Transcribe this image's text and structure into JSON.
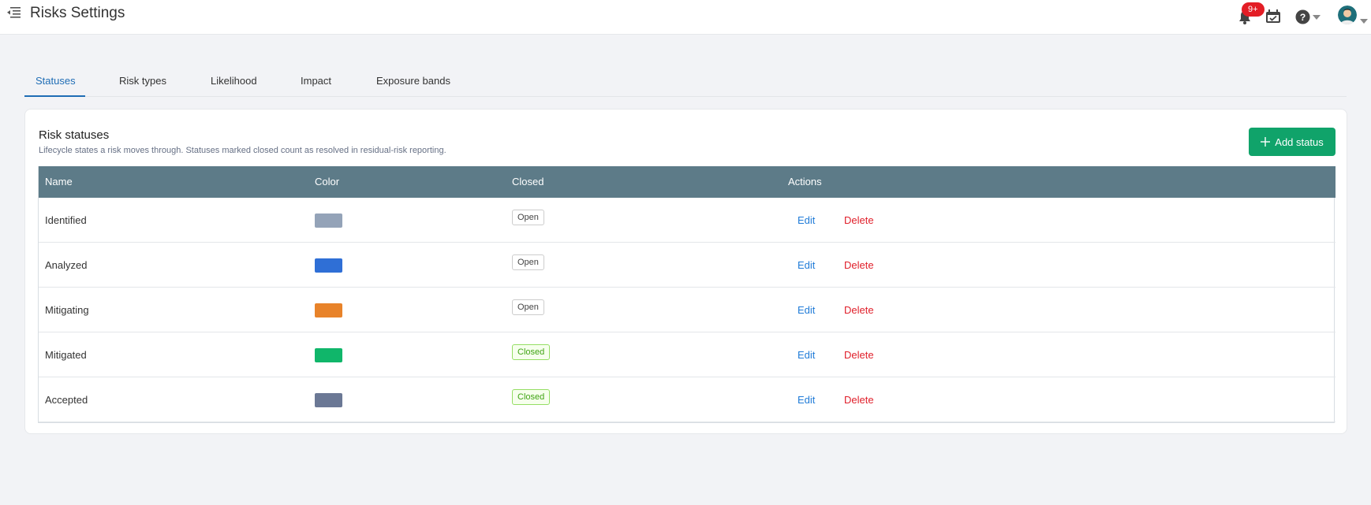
{
  "header": {
    "title": "Risks Settings",
    "notification_count": "9+",
    "icons": [
      "menu-collapse-icon",
      "bell-icon",
      "calendar-check-icon",
      "help-icon",
      "chevron-down-icon",
      "avatar"
    ]
  },
  "tabs": [
    {
      "label": "Statuses",
      "active": true
    },
    {
      "label": "Risk types",
      "active": false
    },
    {
      "label": "Likelihood",
      "active": false
    },
    {
      "label": "Impact",
      "active": false
    },
    {
      "label": "Exposure bands",
      "active": false
    }
  ],
  "card": {
    "title": "Risk statuses",
    "subtitle": "Lifecycle states a risk moves through. Statuses marked closed count as resolved in residual-risk reporting.",
    "add_button": "Add status"
  },
  "table": {
    "columns": [
      "Name",
      "Color",
      "Closed",
      "Actions"
    ],
    "rows": [
      {
        "name": "Identified",
        "color": "#94a3b8",
        "closed": "Open",
        "edit": "Edit",
        "delete": "Delete"
      },
      {
        "name": "Analyzed",
        "color": "#2f6fd6",
        "closed": "Open",
        "edit": "Edit",
        "delete": "Delete"
      },
      {
        "name": "Mitigating",
        "color": "#e8832a",
        "closed": "Open",
        "edit": "Edit",
        "delete": "Delete"
      },
      {
        "name": "Mitigated",
        "color": "#10b66a",
        "closed": "Closed",
        "edit": "Edit",
        "delete": "Delete"
      },
      {
        "name": "Accepted",
        "color": "#6b7895",
        "closed": "Closed",
        "edit": "Edit",
        "delete": "Delete"
      }
    ]
  },
  "colors": {
    "accent": "#1f6db5",
    "primary_button": "#10a36a",
    "table_header": "#5d7b88",
    "danger": "#e0202b",
    "link": "#1f7bd8"
  }
}
